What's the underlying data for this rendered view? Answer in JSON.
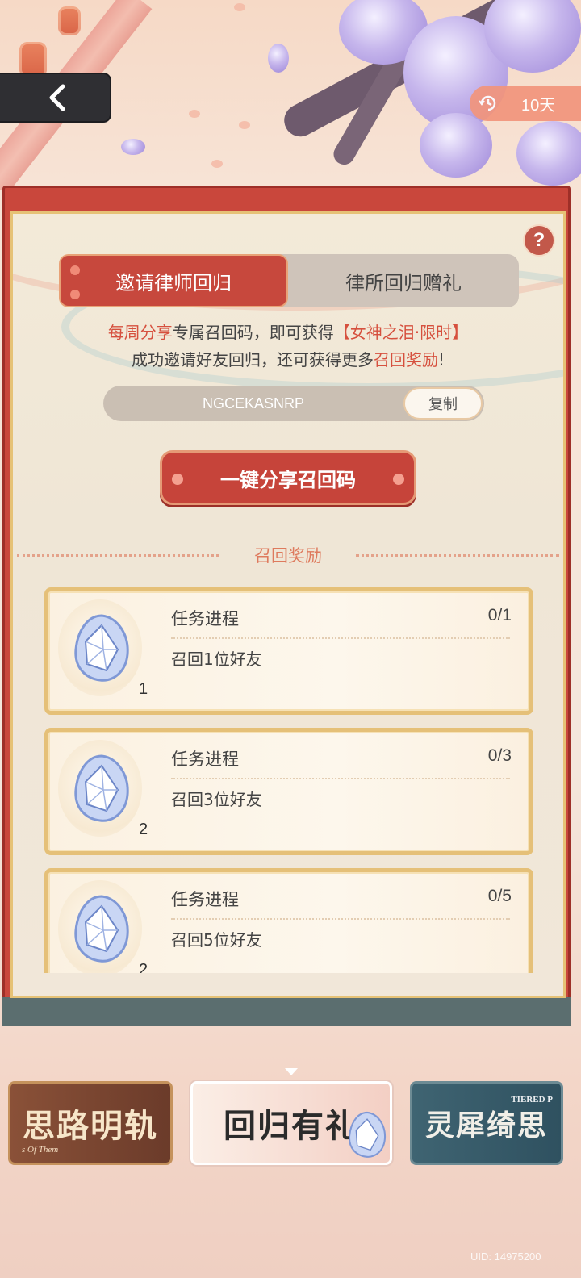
{
  "header": {
    "back_icon": "chevron-left-icon",
    "days_icon": "clock-refresh-icon",
    "days_left": "10天"
  },
  "panel": {
    "help_label": "?",
    "tabs": [
      {
        "label": "邀请律师回归",
        "active": true
      },
      {
        "label": "律所回归赠礼",
        "active": false
      }
    ],
    "invite_line1": {
      "part1": "每周分享",
      "part2": "专属召回码，即可获得",
      "part3": "【女神之泪·限时】"
    },
    "invite_line2": {
      "part1": "成功邀请好友回归，还可获得更多",
      "part2": "召回奖励",
      "part3": "!"
    },
    "recall_code": "NGCEKASNRP",
    "copy_label": "复制",
    "share_label": "一键分享召回码",
    "section_title": "召回奖励",
    "rewards": [
      {
        "item_icon": "crystal-gem-icon",
        "count": "1",
        "label": "任务进程",
        "progress": "0/1",
        "desc": "召回1位好友"
      },
      {
        "item_icon": "crystal-gem-icon",
        "count": "2",
        "label": "任务进程",
        "progress": "0/3",
        "desc": "召回3位好友"
      },
      {
        "item_icon": "crystal-gem-icon",
        "count": "2",
        "label": "任务进程",
        "progress": "0/5",
        "desc": "召回5位好友"
      }
    ]
  },
  "carousel": {
    "items": [
      {
        "title": "思路明轨",
        "subtitle": "s Of Them",
        "active": false
      },
      {
        "title": "回归有礼",
        "subtitle": "",
        "active": true
      },
      {
        "title": "灵犀绮思",
        "subtitle": "TIERED P",
        "active": false
      }
    ]
  },
  "footer": {
    "uid": "UID: 14975200"
  },
  "colors": {
    "accent_red": "#c7483d",
    "highlight_red": "#d6503e",
    "gold_border": "#e5c078",
    "panel_bg": "#efe6d6"
  }
}
